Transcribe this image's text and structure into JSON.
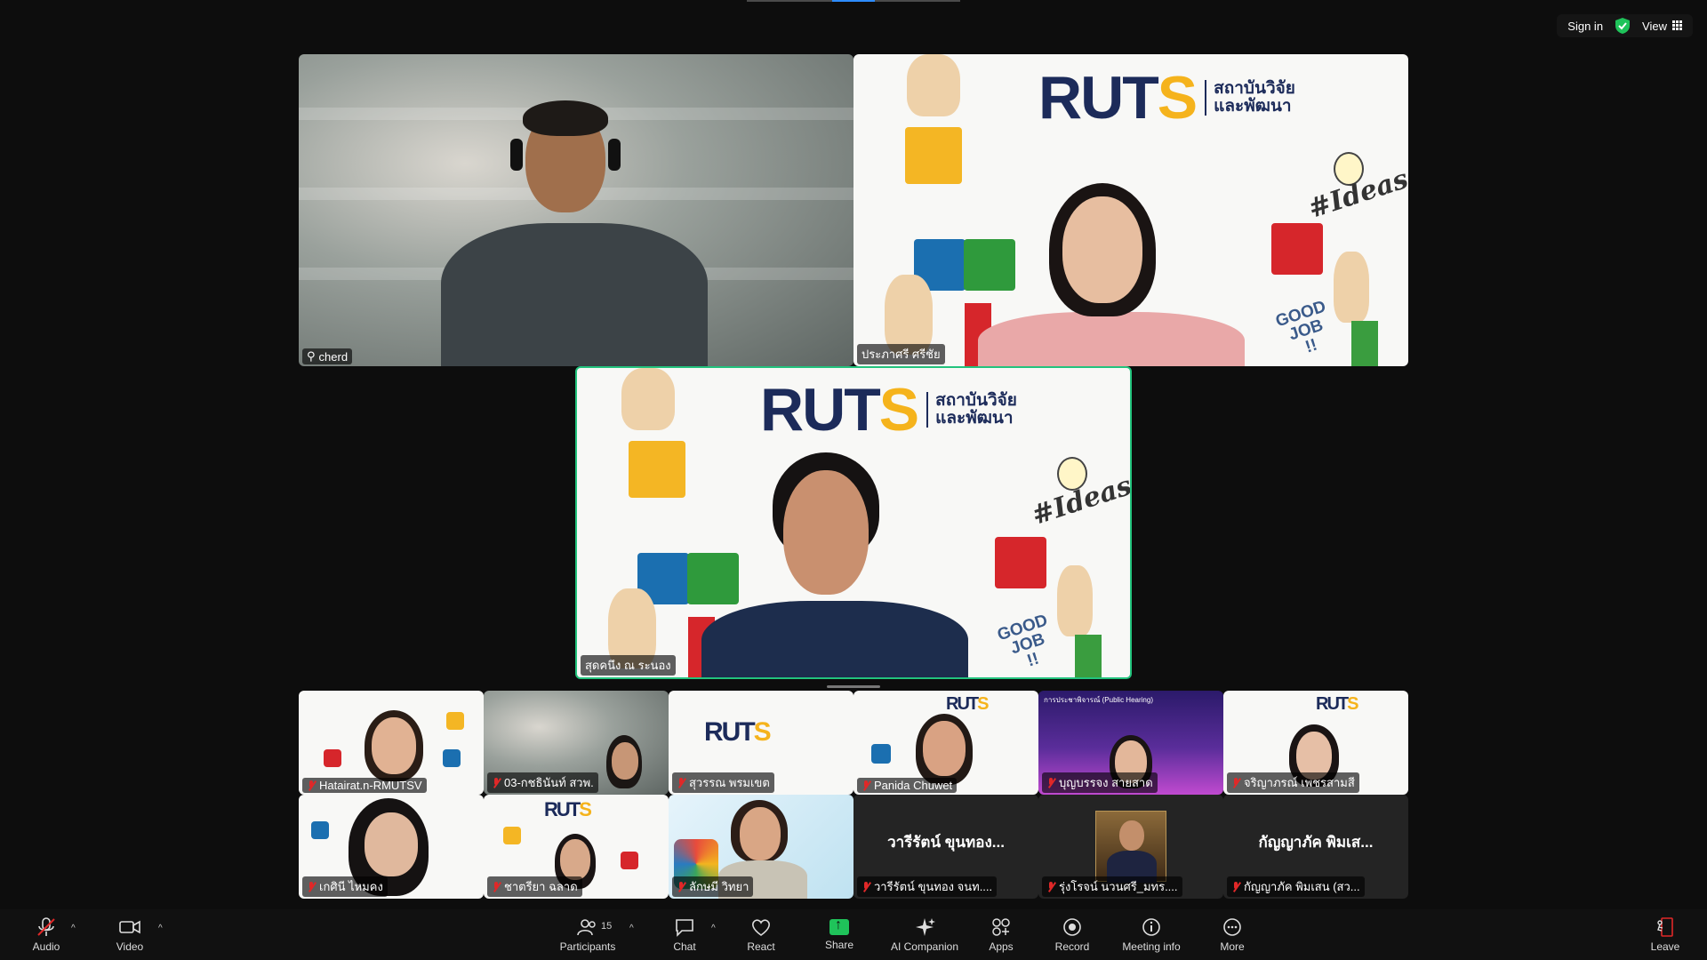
{
  "top_bar": {
    "sign_in": "Sign in",
    "view": "View"
  },
  "colors": {
    "active_speaker": "#22c37d",
    "mic_muted": "#e02828",
    "share_green": "#1fc35a",
    "toolbar_bg": "#111111"
  },
  "main_tiles": [
    {
      "name": "cherd",
      "pinned": true
    },
    {
      "name": "ประภาศรี ศรีชัย"
    },
    {
      "name": "สุดคนึง ณ ระนอง",
      "active_speaker": true
    }
  ],
  "ruts": {
    "logo_word_a": "RUT",
    "logo_word_b": "S",
    "thai_line1": "สถาบันวิจัย",
    "thai_line2": "และพัฒนา",
    "ideas_text": "#Ideas",
    "goodjob_text_1": "GOOD",
    "goodjob_text_2": "JOB",
    "goodjob_text_3": "!!"
  },
  "gallery": [
    {
      "name": "Hatairat.n-RMUTSV",
      "muted": true
    },
    {
      "name": "03-กชธินันท์  สวพ.",
      "muted": true
    },
    {
      "name": "สุวรรณ พรมเขต",
      "muted": true
    },
    {
      "name": "Panida Chuwet",
      "muted": true
    },
    {
      "name": "บุญบรรจง สายสาด",
      "muted": true
    },
    {
      "name": "จริญาภรณ์  เพชรสามสี",
      "muted": true
    },
    {
      "name": "เกศินี ไหมคง",
      "muted": true
    },
    {
      "name": "ชาตรียา ฉลาด",
      "muted": true
    },
    {
      "name": "ลักษมี วิทยา",
      "muted": true
    },
    {
      "name": "วารีรัตน์ ขุนทอง จนท....",
      "muted": true,
      "display_name": "วารีรัตน์  ขุนทอง..."
    },
    {
      "name": "รุ่งโรจน์ นวนศรี_มทร....",
      "muted": true
    },
    {
      "name": "กัญญาภัค พิมเสน (สว...",
      "muted": true,
      "display_name": "กัญญาภัค  พิมเส..."
    }
  ],
  "hearing_banner": "การประชาพิจารณ์ (Public Hearing)",
  "toolbar": {
    "audio": "Audio",
    "video": "Video",
    "participants": "Participants",
    "participants_count": "15",
    "chat": "Chat",
    "react": "React",
    "share": "Share",
    "ai_companion": "AI Companion",
    "apps": "Apps",
    "record": "Record",
    "meeting_info": "Meeting info",
    "more": "More",
    "leave": "Leave"
  }
}
